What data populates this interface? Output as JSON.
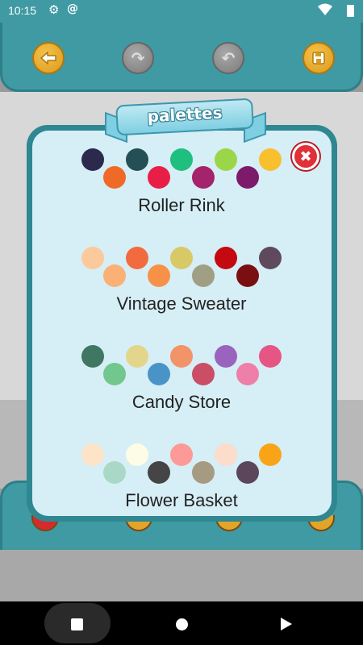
{
  "status_bar": {
    "time": "10:15"
  },
  "dialog": {
    "title": "palettes"
  },
  "palettes": [
    {
      "name": "Roller Rink",
      "colors": [
        "#2b2a4c",
        "#f06a27",
        "#254f57",
        "#e91e47",
        "#1fbf7f",
        "#a4236a",
        "#9bd64a",
        "#7e1a6b",
        "#f8bf2f"
      ]
    },
    {
      "name": "Vintage Sweater",
      "colors": [
        "#fcc99b",
        "#fbb076",
        "#f26b3f",
        "#f79148",
        "#d8c966",
        "#a09e83",
        "#c40910",
        "#7a0f12",
        "#5e4a5c"
      ]
    },
    {
      "name": "Candy Store",
      "colors": [
        "#3f7763",
        "#71c78e",
        "#e3d58b",
        "#4a93c7",
        "#f29368",
        "#c94e66",
        "#9a63bd",
        "#ee7fa8",
        "#e55685"
      ]
    },
    {
      "name": "Flower Basket",
      "colors": [
        "#fde3c7",
        "#a9d9c6",
        "#fdfde5",
        "#454545",
        "#fd9a98",
        "#a69b81",
        "#fcdcca",
        "#5c465b",
        "#f9a417"
      ]
    }
  ],
  "icons": {
    "back": "arrow-left-icon",
    "redo": "redo-icon",
    "undo": "undo-icon",
    "save": "floppy-disk-icon",
    "close": "close-x-icon"
  },
  "colors": {
    "teal": "#3f9aa3",
    "accent_gold": "#f6c24a",
    "close_red": "#e0303a"
  }
}
